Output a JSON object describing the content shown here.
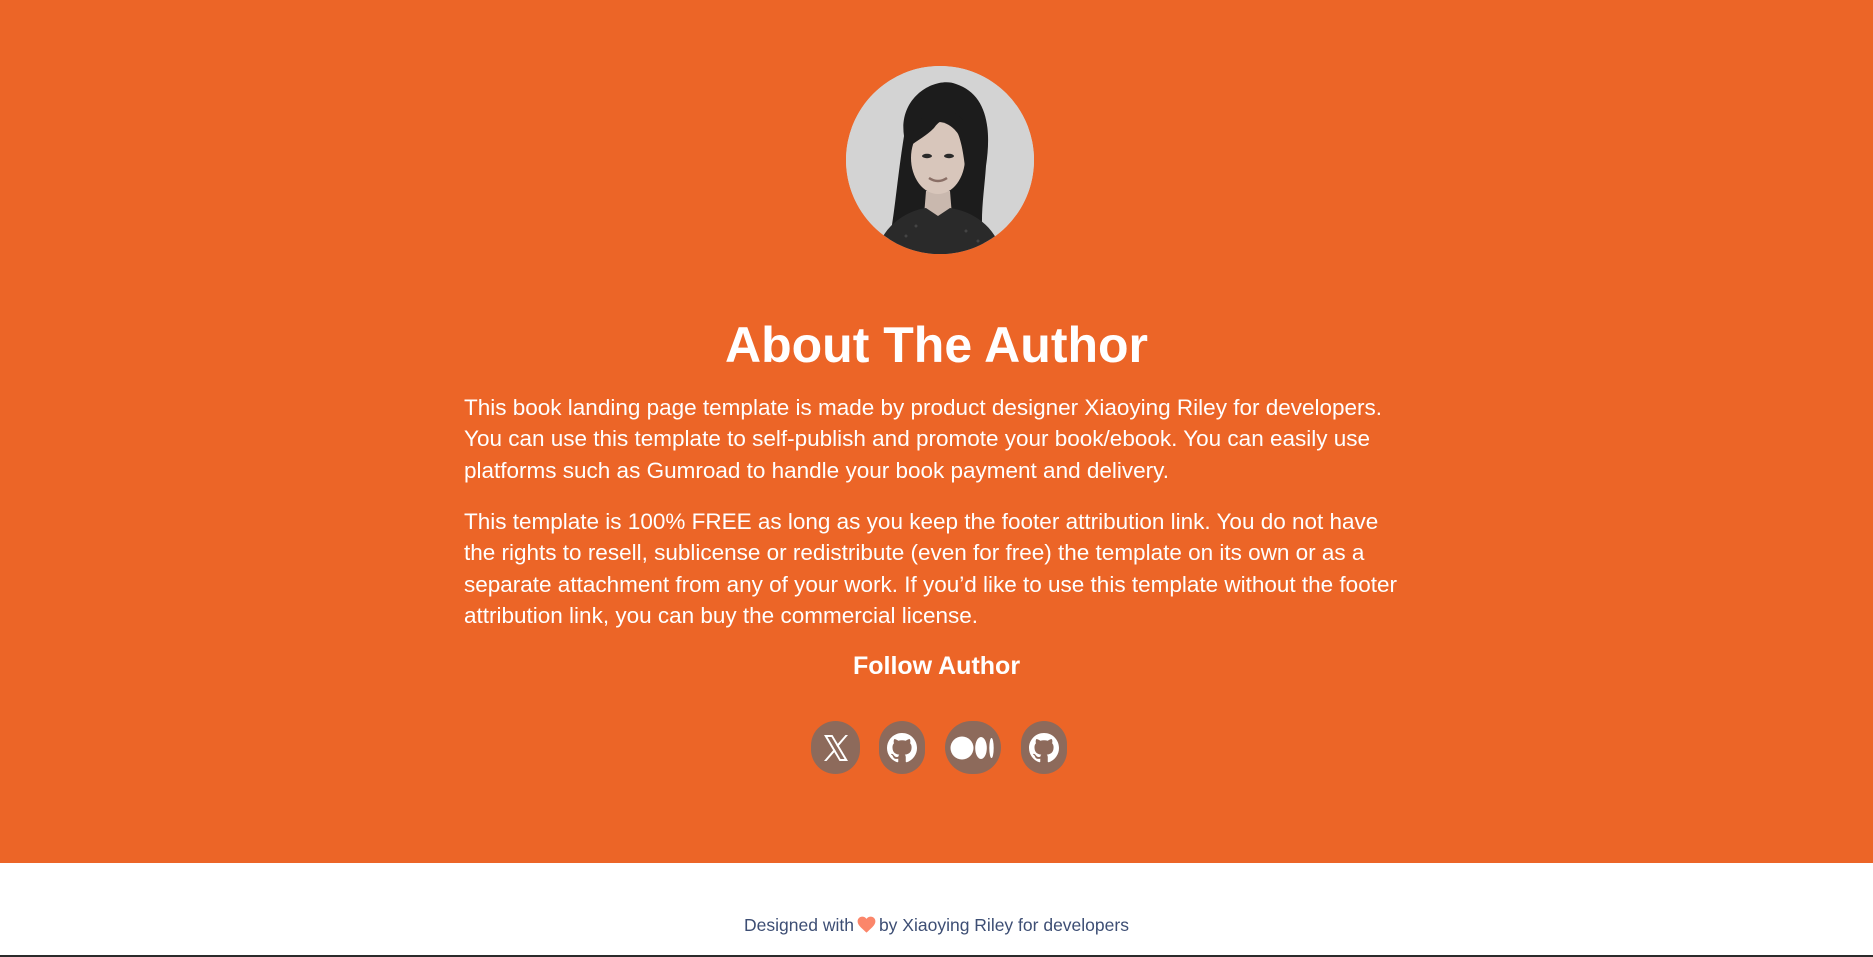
{
  "about": {
    "avatar_alt": "Author photo",
    "title": "About The Author",
    "paragraphs": [
      "This book landing page template is made by product designer Xiaoying Riley for developers. You can use this template to self-publish and promote your book/ebook. You can easily use platforms such as Gumroad to handle your book payment and delivery.",
      "This template is 100% FREE as long as you keep the footer attribution link. You do not have the rights to resell, sublicense or redistribute (even for free) the template on its own or as a separate attachment from any of your work. If you’d like to use this template without the footer attribution link, you can buy the commercial license."
    ],
    "follow_heading": "Follow Author",
    "social_links": [
      {
        "icon": "x-icon"
      },
      {
        "icon": "github-icon"
      },
      {
        "icon": "medium-icon"
      },
      {
        "icon": "github-icon"
      }
    ],
    "colors": {
      "background": "#ec6527",
      "social_button": "#8d6a5b",
      "text": "#ffffff"
    }
  },
  "footer": {
    "text_before": "Designed with",
    "text_after": "by Xiaoying Riley for developers",
    "heart_icon": "heart-icon",
    "colors": {
      "text": "#3d4e74",
      "heart": "#fb866a"
    }
  }
}
